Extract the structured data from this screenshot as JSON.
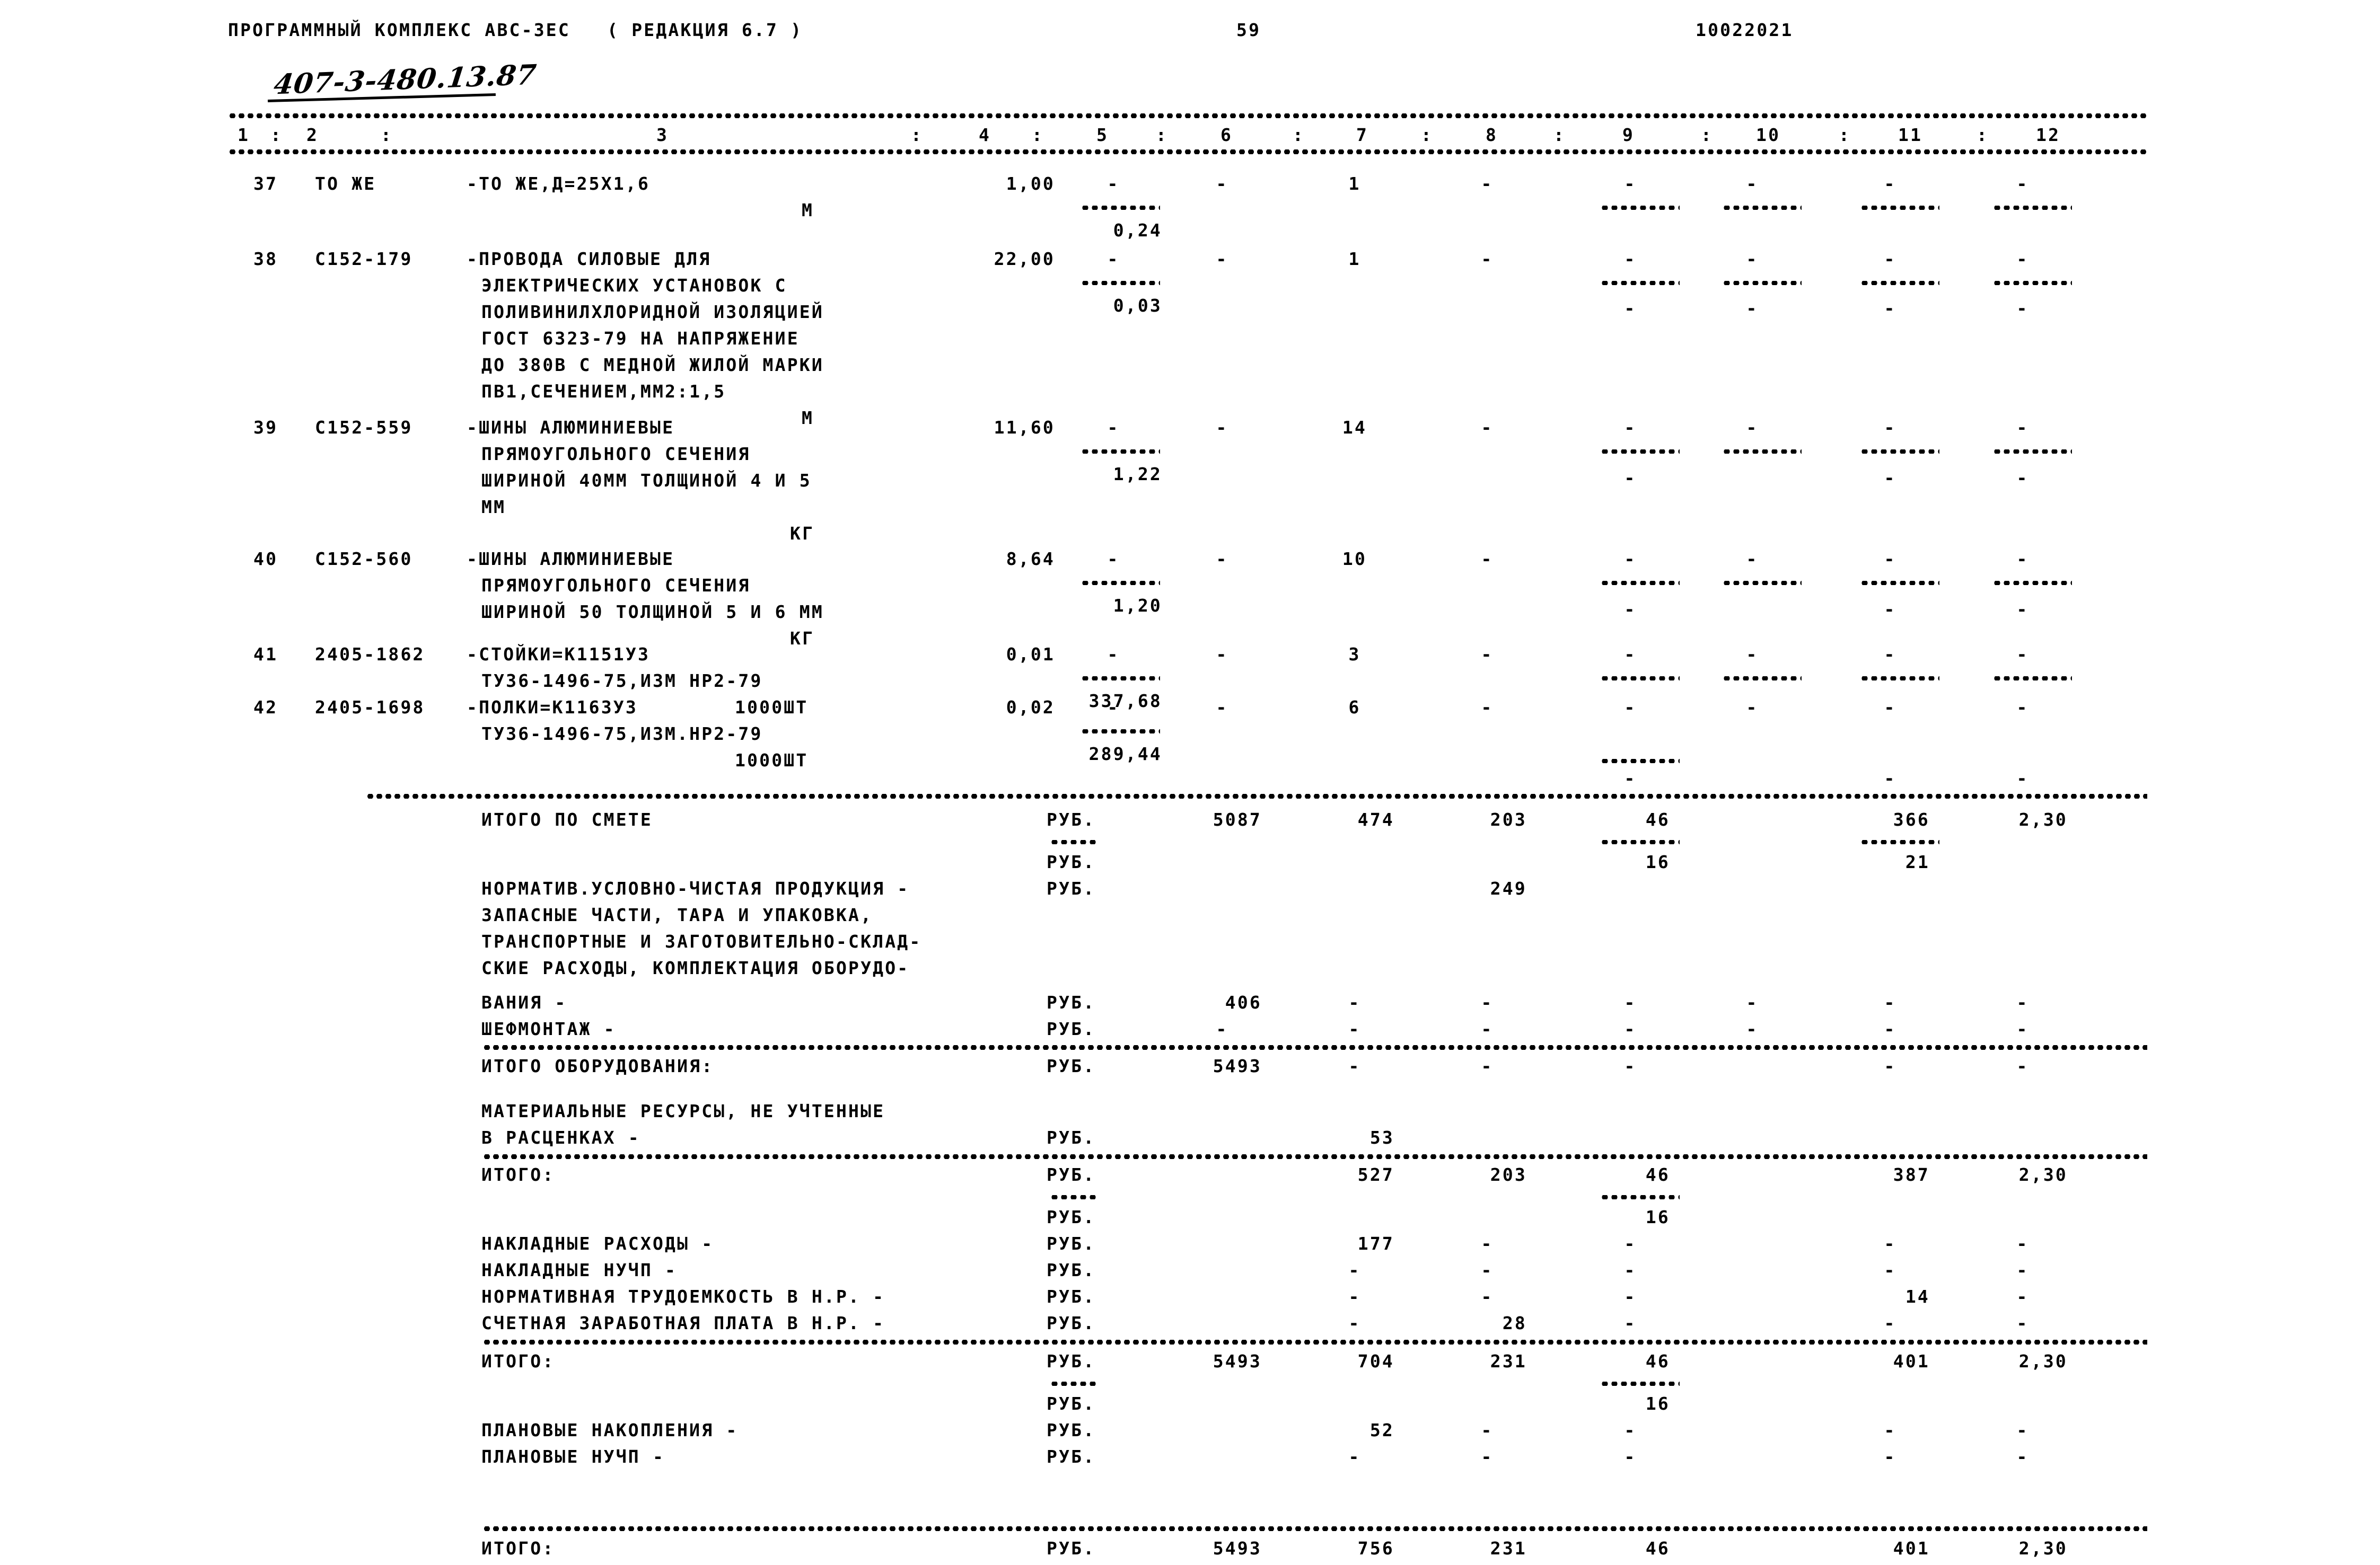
{
  "header": {
    "program_title": "ПРОГРАММНЫЙ КОМПЛЕКС АВС-ЗЕС   ( РЕДАКЦИЯ 6.7 )",
    "page_number": "59",
    "document_code": "10022021",
    "handwritten_annotation": "407-3-480.13.87"
  },
  "columns": {
    "labels": [
      "1",
      "2",
      "3",
      "4",
      "5",
      "6",
      "7",
      "8",
      "9",
      "10",
      "11",
      "12"
    ],
    "separator": ":"
  },
  "items": [
    {
      "num": "37",
      "code": "ТО ЖЕ",
      "desc_lines": [
        "-ТО ЖЕ,Д=25Х1,6"
      ],
      "unit": "М",
      "c4": "1,00",
      "c5_top": "-",
      "c5_bottom": "0,24",
      "c6": "-",
      "c7": "1",
      "c8": "-",
      "c9": "-",
      "c10": "-",
      "c11": "-",
      "c12": "-"
    },
    {
      "num": "38",
      "code": "С152-179",
      "desc_lines": [
        "-ПРОВОДА СИЛОВЫЕ ДЛЯ",
        "ЭЛЕКТРИЧЕСКИХ УСТАНОВОК С",
        "ПОЛИВИНИЛХЛОРИДНОЙ ИЗОЛЯЦИЕЙ",
        "ГОСТ 6323-79 НА НАПРЯЖЕНИЕ",
        "ДО 380В С МЕДНОЙ ЖИЛОЙ МАРКИ",
        "ПВ1,СЕЧЕНИЕМ,ММ2:1,5"
      ],
      "unit": "М",
      "c4": "22,00",
      "c5_top": "-",
      "c5_bottom": "0,03",
      "c6": "-",
      "c7": "1",
      "c8": "-",
      "c9": "-",
      "c10": "-",
      "c11": "-",
      "c12": "-"
    },
    {
      "num": "39",
      "code": "С152-559",
      "desc_lines": [
        "-ШИНЫ АЛЮМИНИЕВЫЕ",
        "ПРЯМОУГОЛЬНОГО СЕЧЕНИЯ",
        "ШИРИНОЙ 40ММ ТОЛЩИНОЙ 4 И 5",
        "ММ"
      ],
      "unit": "КГ",
      "c4": "11,60",
      "c5_top": "-",
      "c5_bottom": "1,22",
      "c6": "-",
      "c7": "14",
      "c8": "-",
      "c9": "-",
      "c10": "-",
      "c11": "-",
      "c12": "-"
    },
    {
      "num": "40",
      "code": "С152-560",
      "desc_lines": [
        "-ШИНЫ АЛЮМИНИЕВЫЕ",
        "ПРЯМОУГОЛЬНОГО СЕЧЕНИЯ",
        "ШИРИНОЙ 50 ТОЛЩИНОЙ 5 И 6 ММ"
      ],
      "unit": "КГ",
      "c4": "8,64",
      "c5_top": "-",
      "c5_bottom": "1,20",
      "c6": "-",
      "c7": "10",
      "c8": "-",
      "c9": "-",
      "c10": "-",
      "c11": "-",
      "c12": "-"
    },
    {
      "num": "41",
      "code": "2405-1862",
      "desc_lines": [
        "-СТОЙКИ=К1151У3",
        "ТУ36-1496-75,ИЗМ НР2-79"
      ],
      "unit": "1000ШТ",
      "c4": "0,01",
      "c5_top": "-",
      "c5_bottom": "337,68",
      "c6": "-",
      "c7": "3",
      "c8": "-",
      "c9": "-",
      "c10": "-",
      "c11": "-",
      "c12": "-"
    },
    {
      "num": "42",
      "code": "2405-1698",
      "desc_lines": [
        "-ПОЛКИ=К1163У3",
        "ТУ36-1496-75,ИЗМ.НР2-79"
      ],
      "unit": "1000ШТ",
      "c4": "0,02",
      "c5_top": "-",
      "c5_bottom": "289,44",
      "c6": "-",
      "c7": "6",
      "c8": "-",
      "c9": "-",
      "c10": "-",
      "c11": "-",
      "c12": "-"
    }
  ],
  "summary": {
    "total_estimate": {
      "label": "ИТОГО ПО СМЕТЕ",
      "unit": "РУБ.",
      "c6": "5087",
      "c7": "474",
      "c8": "203",
      "c9": "46",
      "c11": "366",
      "c12": "2,30"
    },
    "total_estimate_sub": {
      "unit": "РУБ.",
      "c9": "16",
      "c11": "21"
    },
    "nucp": {
      "label_lines": [
        "НОРМАТИВ.УСЛОВНО-ЧИСТАЯ ПРОДУКЦИЯ -",
        "ЗАПАСНЫЕ ЧАСТИ, ТАРА И УПАКОВКА,",
        "ТРАНСПОРТНЫЕ И ЗАГОТОВИТЕЛЬНО-СКЛАД-",
        "СКИЕ РАСХОДЫ, КОМПЛЕКТАЦИЯ ОБОРУДО-",
        "ВАНИЯ -"
      ],
      "unit": "РУБ.",
      "c8": "249"
    },
    "vaniya": {
      "label": "ВАНИЯ -",
      "unit": "РУБ.",
      "c6": "406",
      "c7": "-",
      "c8": "-",
      "c9": "-",
      "c10": "-",
      "c11": "-",
      "c12": "-"
    },
    "shefmontazh": {
      "label": "ШЕФМОНТАЖ -",
      "unit": "РУБ.",
      "c6": "-",
      "c7": "-",
      "c8": "-",
      "c9": "-",
      "c10": "-",
      "c11": "-",
      "c12": "-"
    },
    "equipment_total": {
      "label": "ИТОГО ОБОРУДОВАНИЯ:",
      "unit": "РУБ.",
      "c6": "5493",
      "c7": "-",
      "c8": "-",
      "c9": "-",
      "c11": "-",
      "c12": "-"
    },
    "materials": {
      "label_lines": [
        "МАТЕРИАЛЬНЫЕ РЕСУРСЫ, НЕ УЧТЕННЫЕ",
        "В РАСЦЕНКАХ -"
      ],
      "unit": "РУБ.",
      "c7": "53"
    },
    "itogo1": {
      "label": "ИТОГО:",
      "unit": "РУБ.",
      "c7": "527",
      "c8": "203",
      "c9": "46",
      "c11": "387",
      "c12": "2,30"
    },
    "itogo1_sub": {
      "unit": "РУБ.",
      "c9": "16"
    },
    "overhead": {
      "label": "НАКЛАДНЫЕ РАСХОДЫ -",
      "unit": "РУБ.",
      "c7": "177",
      "c8": "-",
      "c9": "-",
      "c11": "-",
      "c12": "-"
    },
    "overhead_nucp": {
      "label": "НАКЛАДНЫЕ НУЧП -",
      "unit": "РУБ.",
      "c7": "-",
      "c8": "-",
      "c9": "-",
      "c11": "-",
      "c12": "-"
    },
    "normative_labor": {
      "label": "НОРМАТИВНАЯ ТРУДОЕМКОСТЬ В Н.Р. -",
      "unit": "РУБ.",
      "c7": "-",
      "c8": "-",
      "c9": "-",
      "c11": "14",
      "c12": "-"
    },
    "calc_wage": {
      "label": "СЧЕТНАЯ ЗАРАБОТНАЯ ПЛАТА В Н.Р. -",
      "unit": "РУБ.",
      "c7": "-",
      "c8": "28",
      "c9": "-",
      "c11": "-",
      "c12": "-"
    },
    "itogo2": {
      "label": "ИТОГО:",
      "unit": "РУБ.",
      "c6": "5493",
      "c7": "704",
      "c8": "231",
      "c9": "46",
      "c11": "401",
      "c12": "2,30"
    },
    "itogo2_sub": {
      "unit": "РУБ.",
      "c9": "16"
    },
    "planned_savings": {
      "label": "ПЛАНОВЫЕ НАКОПЛЕНИЯ -",
      "unit": "РУБ.",
      "c7": "52",
      "c8": "-",
      "c9": "-",
      "c11": "-",
      "c12": "-"
    },
    "planned_nucp": {
      "label": "ПЛАНОВЫЕ НУЧП -",
      "unit": "РУБ.",
      "c7": "-",
      "c8": "-",
      "c9": "-",
      "c11": "-",
      "c12": "-"
    },
    "itogo3": {
      "label": "ИТОГО:",
      "unit": "РУБ.",
      "c6": "5493",
      "c7": "756",
      "c8": "231",
      "c9": "46",
      "c11": "401",
      "c12": "2,30"
    }
  }
}
